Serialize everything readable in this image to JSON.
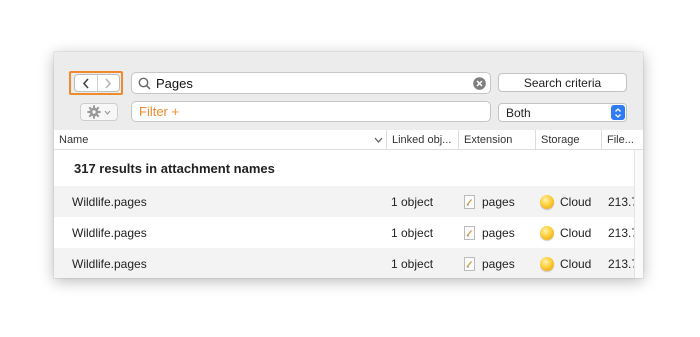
{
  "toolbar": {
    "search": {
      "value": "Pages",
      "icon": "search-icon"
    },
    "search_criteria_label": "Search criteria",
    "filter_placeholder": "Filter +",
    "scope_select": {
      "selected": "Both"
    },
    "accent_color": "#f08a2a",
    "select_accent_color": "#2f7bf6"
  },
  "table": {
    "columns": [
      "Name",
      "Linked obj...",
      "Extension",
      "Storage",
      "File..."
    ],
    "group_header": "317 results in attachment names",
    "rows": [
      {
        "name": "Wildlife.pages",
        "linked": "1 object",
        "extension": "pages",
        "storage": "Cloud",
        "size": "213.7"
      },
      {
        "name": "Wildlife.pages",
        "linked": "1 object",
        "extension": "pages",
        "storage": "Cloud",
        "size": "213.7"
      },
      {
        "name": "Wildlife.pages",
        "linked": "1 object",
        "extension": "pages",
        "storage": "Cloud",
        "size": "213.7"
      }
    ]
  }
}
